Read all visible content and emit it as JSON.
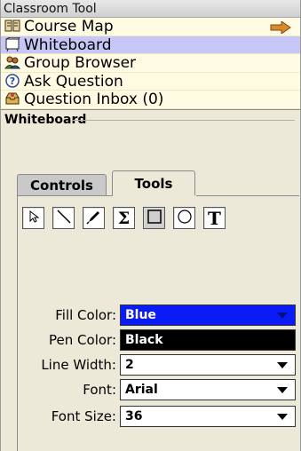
{
  "window": {
    "title": "Classroom Tool"
  },
  "nav": {
    "items": [
      {
        "label": "Course Map",
        "icon": "book-icon",
        "selected": false
      },
      {
        "label": "Whiteboard",
        "icon": "whiteboard-icon",
        "selected": true
      },
      {
        "label": "Group Browser",
        "icon": "group-icon",
        "selected": false
      },
      {
        "label": "Ask Question",
        "icon": "question-icon",
        "selected": false
      },
      {
        "label": "Question Inbox (0)",
        "icon": "inbox-icon",
        "selected": false
      }
    ],
    "course_map_arrow_icon": "arrow-right-icon"
  },
  "section": {
    "title": "Whiteboard"
  },
  "tabs": [
    {
      "label": "Controls",
      "active": false
    },
    {
      "label": "Tools",
      "active": true
    }
  ],
  "tools": [
    {
      "name": "select-tool",
      "icon": "cursor-icon",
      "selected": false
    },
    {
      "name": "line-tool",
      "icon": "line-icon",
      "selected": false
    },
    {
      "name": "pen-tool",
      "icon": "pencil-icon",
      "selected": false
    },
    {
      "name": "equation-tool",
      "icon": "sigma-icon",
      "glyph": "Σ",
      "selected": false
    },
    {
      "name": "rectangle-tool",
      "icon": "rectangle-icon",
      "selected": true
    },
    {
      "name": "ellipse-tool",
      "icon": "circle-icon",
      "selected": false
    },
    {
      "name": "text-tool",
      "icon": "text-icon",
      "glyph": "T",
      "selected": false
    }
  ],
  "form": {
    "fill_color": {
      "label": "Fill Color:",
      "value": "Blue",
      "color": "#0b1bf5"
    },
    "pen_color": {
      "label": "Pen Color:",
      "value": "Black",
      "color": "#000000"
    },
    "line_width": {
      "label": "Line Width:",
      "value": "2"
    },
    "font": {
      "label": "Font:",
      "value": "Arial"
    },
    "font_size": {
      "label": "Font Size:",
      "value": "36"
    }
  },
  "colors": {
    "nav_background": "#fffbe2",
    "nav_selected": "#c7c7f7",
    "panel_background": "#ece9d8",
    "arrow": "#d98a2b"
  }
}
